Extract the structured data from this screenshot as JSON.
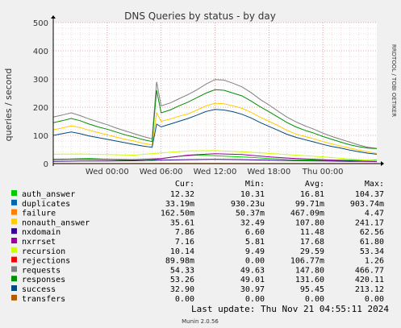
{
  "chart_data": {
    "type": "line",
    "title": "DNS Queries by status - by day",
    "ylabel": "queries / second",
    "side_label": "RRDTOOL / TOBI OETIKER",
    "ylim": [
      0,
      500
    ],
    "yticks": [
      0,
      100,
      200,
      300,
      400,
      500
    ],
    "x_ticks": [
      {
        "label": "Wed 00:00",
        "hours": 6
      },
      {
        "label": "Wed 06:00",
        "hours": 12
      },
      {
        "label": "Wed 12:00",
        "hours": 18
      },
      {
        "label": "Wed 18:00",
        "hours": 24
      },
      {
        "label": "Thu 00:00",
        "hours": 30
      }
    ],
    "x_range_hours": [
      0,
      36
    ],
    "grid": true,
    "legend_headers": [
      "Cur:",
      "Min:",
      "Avg:",
      "Max:"
    ],
    "series": [
      {
        "name": "auth_answer",
        "color": "#00cc00",
        "cur": "12.32",
        "min": "10.31",
        "avg": "16.81",
        "max": "104.37",
        "x": [
          0,
          2,
          4,
          6,
          8,
          10,
          11,
          12,
          13,
          14,
          16,
          18,
          20,
          22,
          24,
          26,
          28,
          30,
          32,
          34,
          36
        ],
        "y": [
          14,
          16,
          18,
          15,
          12,
          11,
          13,
          17,
          22,
          26,
          30,
          28,
          25,
          22,
          18,
          15,
          13,
          12,
          12,
          12,
          12
        ]
      },
      {
        "name": "duplicates",
        "color": "#0066b3",
        "cur": "33.19m",
        "min": "930.23u",
        "avg": "99.71m",
        "max": "903.74m",
        "x": [
          0,
          6,
          12,
          18,
          24,
          30,
          36
        ],
        "y": [
          0.1,
          0.1,
          0.1,
          0.1,
          0.1,
          0.1,
          0.03
        ]
      },
      {
        "name": "failure",
        "color": "#ff8000",
        "cur": "162.50m",
        "min": "50.37m",
        "avg": "467.09m",
        "max": "4.47",
        "x": [
          0,
          6,
          12,
          18,
          24,
          30,
          36
        ],
        "y": [
          0.4,
          0.4,
          0.5,
          0.5,
          0.4,
          0.4,
          0.16
        ]
      },
      {
        "name": "nonauth_answer",
        "color": "#ffcc00",
        "cur": "35.61",
        "min": "32.49",
        "avg": "107.80",
        "max": "241.17",
        "x": [
          0,
          1,
          2,
          3,
          4,
          5,
          6,
          7,
          8,
          9,
          10,
          11,
          11.5,
          12,
          13,
          14,
          15,
          16,
          17,
          18,
          19,
          20,
          21,
          22,
          23,
          24,
          25,
          26,
          27,
          28,
          29,
          30,
          31,
          32,
          33,
          34,
          35,
          36
        ],
        "y": [
          120,
          126,
          134,
          128,
          118,
          110,
          102,
          94,
          86,
          80,
          72,
          66,
          180,
          150,
          158,
          168,
          176,
          190,
          205,
          214,
          212,
          205,
          196,
          182,
          165,
          150,
          135,
          118,
          105,
          96,
          88,
          78,
          70,
          62,
          55,
          48,
          42,
          36
        ]
      },
      {
        "name": "nxdomain",
        "color": "#330099",
        "cur": "7.86",
        "min": "6.60",
        "avg": "11.48",
        "max": "62.56",
        "x": [
          0,
          3,
          6,
          9,
          12,
          15,
          18,
          21,
          24,
          27,
          30,
          33,
          36
        ],
        "y": [
          8,
          9,
          9,
          10,
          12,
          14,
          15,
          14,
          12,
          10,
          9,
          8,
          8
        ]
      },
      {
        "name": "nxrrset",
        "color": "#990099",
        "cur": "7.16",
        "min": "5.81",
        "avg": "17.68",
        "max": "61.80",
        "x": [
          0,
          3,
          6,
          9,
          12,
          15,
          18,
          21,
          24,
          27,
          30,
          33,
          36
        ],
        "y": [
          15,
          16,
          15,
          14,
          18,
          30,
          35,
          32,
          24,
          18,
          14,
          10,
          7
        ]
      },
      {
        "name": "recursion",
        "color": "#ccff00",
        "cur": "10.14",
        "min": "9.49",
        "avg": "29.59",
        "max": "53.34",
        "x": [
          0,
          3,
          6,
          9,
          12,
          15,
          18,
          21,
          24,
          27,
          30,
          33,
          36
        ],
        "y": [
          33,
          34,
          32,
          30,
          38,
          45,
          46,
          42,
          36,
          30,
          24,
          16,
          10
        ]
      },
      {
        "name": "rejections",
        "color": "#ff0000",
        "cur": "89.98m",
        "min": "0.00",
        "avg": "106.77m",
        "max": "1.26",
        "x": [
          0,
          6,
          12,
          18,
          24,
          30,
          36
        ],
        "y": [
          0.1,
          0.1,
          0.1,
          0.1,
          0.1,
          0.1,
          0.09
        ]
      },
      {
        "name": "requests",
        "color": "#808080",
        "cur": "54.33",
        "min": "49.63",
        "avg": "147.80",
        "max": "466.77",
        "x": [
          0,
          1,
          2,
          3,
          4,
          5,
          6,
          7,
          8,
          9,
          10,
          11,
          11.5,
          12,
          13,
          14,
          15,
          16,
          17,
          18,
          19,
          20,
          21,
          22,
          23,
          24,
          25,
          26,
          27,
          28,
          29,
          30,
          31,
          32,
          33,
          34,
          35,
          36
        ],
        "y": [
          165,
          172,
          180,
          170,
          158,
          148,
          138,
          126,
          116,
          106,
          96,
          88,
          290,
          205,
          215,
          230,
          245,
          262,
          282,
          298,
          296,
          285,
          272,
          252,
          228,
          208,
          186,
          165,
          148,
          134,
          122,
          108,
          96,
          86,
          76,
          66,
          58,
          54
        ]
      },
      {
        "name": "responses",
        "color": "#008f00",
        "cur": "53.26",
        "min": "49.01",
        "avg": "131.60",
        "max": "420.11",
        "x": [
          0,
          1,
          2,
          3,
          4,
          5,
          6,
          7,
          8,
          9,
          10,
          11,
          11.5,
          12,
          13,
          14,
          15,
          16,
          17,
          18,
          19,
          20,
          21,
          22,
          23,
          24,
          25,
          26,
          27,
          28,
          29,
          30,
          31,
          32,
          33,
          34,
          35,
          36
        ],
        "y": [
          145,
          152,
          160,
          152,
          140,
          130,
          122,
          112,
          102,
          94,
          85,
          78,
          260,
          180,
          190,
          205,
          218,
          234,
          250,
          262,
          260,
          250,
          240,
          222,
          202,
          184,
          165,
          146,
          130,
          118,
          108,
          96,
          86,
          76,
          67,
          60,
          55,
          53
        ]
      },
      {
        "name": "success",
        "color": "#00487d",
        "cur": "32.90",
        "min": "30.97",
        "avg": "95.45",
        "max": "213.12",
        "x": [
          0,
          1,
          2,
          3,
          4,
          5,
          6,
          7,
          8,
          9,
          10,
          11,
          11.5,
          12,
          13,
          14,
          15,
          16,
          17,
          18,
          19,
          20,
          21,
          22,
          23,
          24,
          25,
          26,
          27,
          28,
          29,
          30,
          31,
          32,
          33,
          34,
          35,
          36
        ],
        "y": [
          100,
          106,
          112,
          106,
          98,
          92,
          86,
          80,
          74,
          68,
          62,
          58,
          140,
          130,
          140,
          150,
          160,
          172,
          185,
          192,
          190,
          184,
          175,
          162,
          146,
          132,
          118,
          104,
          93,
          85,
          77,
          68,
          61,
          55,
          48,
          42,
          37,
          33
        ]
      },
      {
        "name": "transfers",
        "color": "#b35a00",
        "cur": "0.00",
        "min": "0.00",
        "avg": "0.00",
        "max": "0.00",
        "x": [
          0,
          36
        ],
        "y": [
          0,
          0
        ]
      }
    ]
  },
  "footer": {
    "last_update": "Last update: Thu Nov 21 04:55:11 2024",
    "munin": "Munin 2.0.56"
  }
}
